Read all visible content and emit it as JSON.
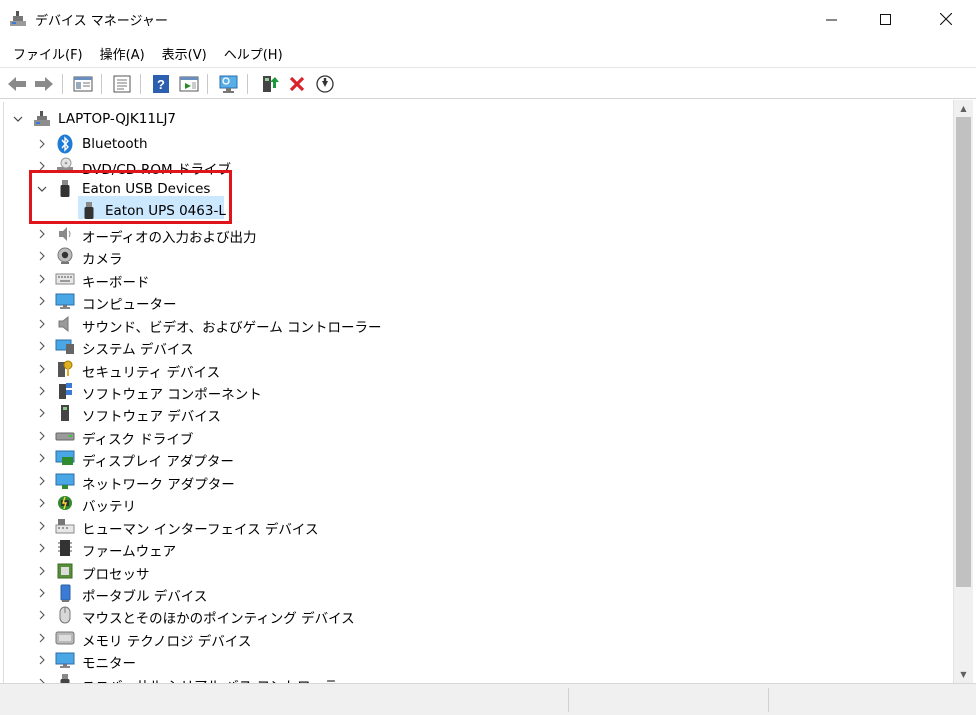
{
  "window": {
    "title": "デバイス マネージャー",
    "icon": "device-manager-icon",
    "controls": [
      "minimize-icon",
      "maximize-icon",
      "close-icon"
    ]
  },
  "menu": [
    {
      "label": "ファイル(F)"
    },
    {
      "label": "操作(A)"
    },
    {
      "label": "表示(V)"
    },
    {
      "label": "ヘルプ(H)"
    }
  ],
  "toolbar": [
    {
      "icon": "back-arrow-icon"
    },
    {
      "icon": "forward-arrow-icon"
    },
    {
      "icon": "show-hide-console-tree-icon"
    },
    {
      "icon": "properties-icon"
    },
    {
      "icon": "help-icon"
    },
    {
      "icon": "action-pane-icon"
    },
    {
      "icon": "scan-hardware-changes-icon"
    },
    {
      "icon": "update-driver-icon"
    },
    {
      "icon": "uninstall-device-icon"
    },
    {
      "icon": "disable-device-icon"
    }
  ],
  "tree": {
    "root": {
      "label": "LAPTOP-QJK11LJ7",
      "icon": "computer-root-icon",
      "expanded": true
    },
    "items": [
      {
        "label": "Bluetooth",
        "icon": "bluetooth-icon",
        "expanded": false
      },
      {
        "label": "DVD/CD-ROM ドライブ",
        "icon": "dvd-drive-icon",
        "expanded": false
      },
      {
        "label": "Eaton USB Devices",
        "icon": "usb-plug-icon",
        "expanded": true,
        "children": [
          {
            "label": "Eaton UPS 0463-L",
            "icon": "usb-plug-icon",
            "selected": true
          }
        ]
      },
      {
        "label": "オーディオの入力および出力",
        "icon": "audio-io-icon",
        "expanded": false
      },
      {
        "label": "カメラ",
        "icon": "camera-icon",
        "expanded": false
      },
      {
        "label": "キーボード",
        "icon": "keyboard-icon",
        "expanded": false
      },
      {
        "label": "コンピューター",
        "icon": "monitor-icon",
        "expanded": false
      },
      {
        "label": "サウンド、ビデオ、およびゲーム コントローラー",
        "icon": "speaker-icon",
        "expanded": false
      },
      {
        "label": "システム デバイス",
        "icon": "system-devices-icon",
        "expanded": false
      },
      {
        "label": "セキュリティ デバイス",
        "icon": "security-key-icon",
        "expanded": false
      },
      {
        "label": "ソフトウェア コンポーネント",
        "icon": "software-component-icon",
        "expanded": false
      },
      {
        "label": "ソフトウェア デバイス",
        "icon": "software-device-icon",
        "expanded": false
      },
      {
        "label": "ディスク ドライブ",
        "icon": "disk-drive-icon",
        "expanded": false
      },
      {
        "label": "ディスプレイ アダプター",
        "icon": "display-adapter-icon",
        "expanded": false
      },
      {
        "label": "ネットワーク アダプター",
        "icon": "network-adapter-icon",
        "expanded": false
      },
      {
        "label": "バッテリ",
        "icon": "battery-icon",
        "expanded": false
      },
      {
        "label": "ヒューマン インターフェイス デバイス",
        "icon": "hid-icon",
        "expanded": false
      },
      {
        "label": "ファームウェア",
        "icon": "firmware-chip-icon",
        "expanded": false
      },
      {
        "label": "プロセッサ",
        "icon": "processor-icon",
        "expanded": false
      },
      {
        "label": "ポータブル デバイス",
        "icon": "portable-device-icon",
        "expanded": false
      },
      {
        "label": "マウスとそのほかのポインティング デバイス",
        "icon": "mouse-icon",
        "expanded": false
      },
      {
        "label": "メモリ テクノロジ デバイス",
        "icon": "memory-technology-icon",
        "expanded": false
      },
      {
        "label": "モニター",
        "icon": "monitor-icon",
        "expanded": false
      },
      {
        "label": "ユニバーサル シリアル バス コントローラー",
        "icon": "usb-controller-icon",
        "expanded": false
      }
    ]
  },
  "colors": {
    "selection": "#cce8ff",
    "highlight_box": "#e0151c",
    "accent_blue": "#1e7bd6"
  }
}
